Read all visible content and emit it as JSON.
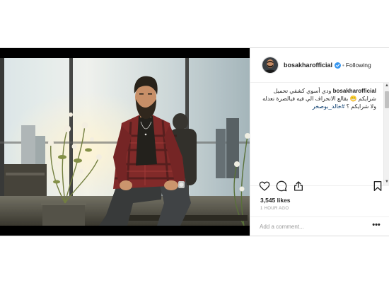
{
  "post": {
    "username": "bosakharofficial",
    "follow_state": "Following",
    "header_separator": "•",
    "verified": true,
    "caption": {
      "user": "bosakharofficial",
      "text": "ودي أسوي كشفي تحميل شرايكم 😬 بقالع الانحراف الي فيه فيالصرة نعدله ولا شرايكم ؟",
      "hashtag": "#خالد_بوصخر"
    },
    "likes": "3,545 likes",
    "timestamp": "1 HOUR AGO",
    "comment_placeholder": "Add a comment...",
    "more_label": "•••",
    "icons": {
      "like": "heart-icon",
      "comment": "comment-icon",
      "share": "share-icon",
      "save": "bookmark-icon",
      "verified": "verified-badge-icon"
    },
    "colors": {
      "verified_badge": "#3897f0",
      "hashtag": "#003569",
      "text": "#262626",
      "muted": "#999999"
    }
  }
}
